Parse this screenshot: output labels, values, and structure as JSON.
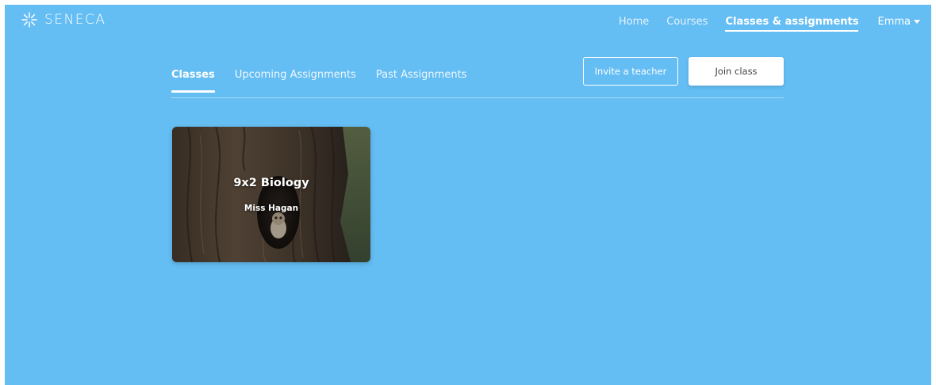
{
  "brand": {
    "name": "SENECA",
    "icon": "seneca-star-logo-icon"
  },
  "nav": {
    "home": "Home",
    "courses": "Courses",
    "classes": "Classes & assignments",
    "user": "Emma",
    "user_icon": "chevron-down-icon"
  },
  "tabs": [
    {
      "label": "Classes",
      "active": true
    },
    {
      "label": "Upcoming Assignments",
      "active": false
    },
    {
      "label": "Past Assignments",
      "active": false
    }
  ],
  "actions": {
    "invite": "Invite a teacher",
    "join": "Join class"
  },
  "classes": [
    {
      "name": "9x2 Biology",
      "teacher": "Miss Hagan",
      "image": "owl-in-tree-hollow"
    }
  ],
  "colors": {
    "background": "#64bdf3",
    "text": "#ffffff",
    "button_text": "#444444"
  }
}
